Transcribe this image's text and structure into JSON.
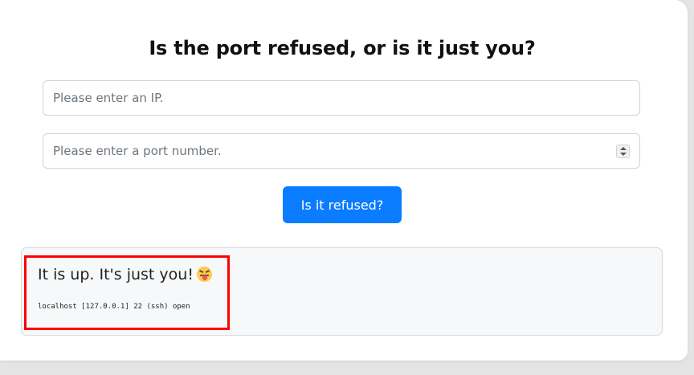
{
  "page": {
    "title": "Is the port refused, or is it just you?"
  },
  "form": {
    "ip_placeholder": "Please enter an IP.",
    "ip_value": "",
    "port_placeholder": "Please enter a port number.",
    "port_value": "",
    "submit_label": "Is it refused?"
  },
  "result": {
    "message": "It is up. It's just you!",
    "emoji": "squinting-face-with-tongue-icon",
    "output": "localhost [127.0.0.1] 22 (ssh) open"
  },
  "colors": {
    "accent": "#0a7cff",
    "highlight_border": "#ff0000",
    "result_background": "#f7f8f9"
  }
}
